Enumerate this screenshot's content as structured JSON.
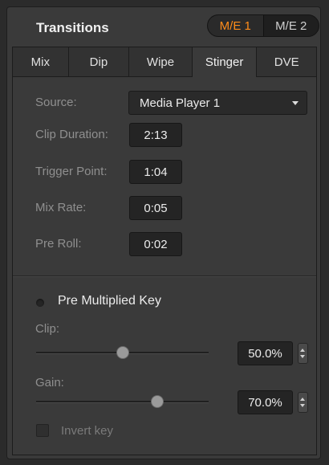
{
  "panel": {
    "title": "Transitions",
    "me_buttons": [
      {
        "label": "M/E 1",
        "active": true
      },
      {
        "label": "M/E 2",
        "active": false
      }
    ],
    "tabs": [
      {
        "label": "Mix",
        "active": false
      },
      {
        "label": "Dip",
        "active": false
      },
      {
        "label": "Wipe",
        "active": false
      },
      {
        "label": "Stinger",
        "active": true
      },
      {
        "label": "DVE",
        "active": false
      }
    ]
  },
  "stinger": {
    "source_label": "Source:",
    "source_value": "Media Player 1",
    "clip_duration_label": "Clip Duration:",
    "clip_duration_value": "2:13",
    "trigger_point_label": "Trigger Point:",
    "trigger_point_value": "1:04",
    "mix_rate_label": "Mix Rate:",
    "mix_rate_value": "0:05",
    "pre_roll_label": "Pre Roll:",
    "pre_roll_value": "0:02"
  },
  "key": {
    "pre_multiplied_label": "Pre Multiplied Key",
    "pre_multiplied_enabled": false,
    "clip_label": "Clip:",
    "clip_value": "50.0%",
    "clip_level": 0.5,
    "gain_label": "Gain:",
    "gain_value": "70.0%",
    "gain_level": 0.7,
    "invert_label": "Invert key",
    "invert_checked": false
  },
  "colors": {
    "accent": "#ff8c1a",
    "panel_bg": "#3a3a3a",
    "field_bg": "#242424"
  }
}
